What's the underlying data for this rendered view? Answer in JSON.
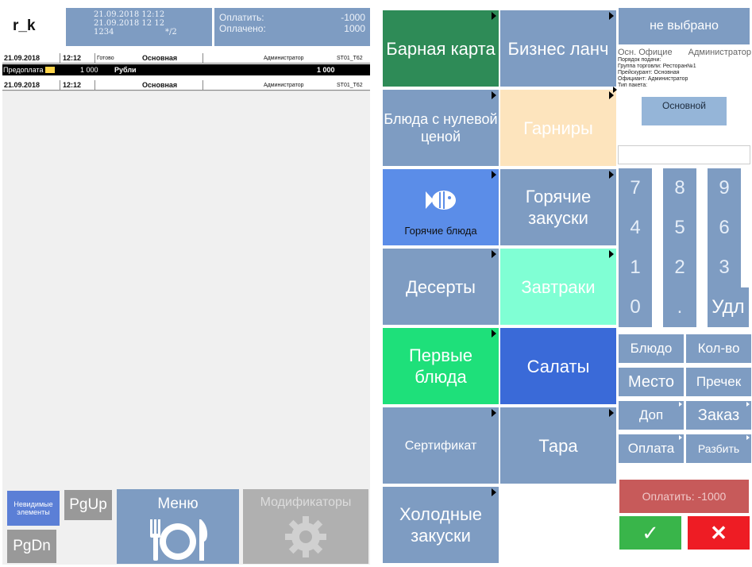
{
  "header": {
    "user": "r_k",
    "time_1": "21.09.2018 12:12",
    "time_2": "21.09.2018 12 12",
    "code": "1234",
    "guests": "*/2",
    "pay_label": "Оплатить:",
    "pay_value": "-1000",
    "paid_label": "Оплачено:",
    "paid_value": "1000"
  },
  "orders": [
    {
      "date": "21.09.2018",
      "time": "12:12",
      "status": "Готово",
      "type": "Основная",
      "waiter": "Администратор",
      "table": "ST01_T62"
    },
    {
      "date": "21.09.2018",
      "time": "12:12",
      "status": "",
      "type": "Основная",
      "waiter": "Администратор",
      "table": "ST01_T62"
    }
  ],
  "prepay": {
    "label": "Предоплата",
    "amount": "1 000",
    "currency": "Рубли",
    "total": "1 000"
  },
  "bottom_left": {
    "invisible": "Невидимые элементы",
    "pgup": "PgUp",
    "pgdn": "PgDn",
    "menu": "Меню",
    "modifiers": "Модификаторы"
  },
  "categories": [
    {
      "label": "Барная карта",
      "color": "#2e8b57"
    },
    {
      "label": "Бизнес ланч",
      "color": "#7e9cc2"
    },
    {
      "label": "Блюда с нулевой ценой",
      "color": "#7e9cc2"
    },
    {
      "label": "Гарниры",
      "color": "#fde4bd"
    },
    {
      "label": "Горячие блюда",
      "color": "#5b8de8"
    },
    {
      "label": "Горячие закуски",
      "color": "#7e9cc2"
    },
    {
      "label": "Десерты",
      "color": "#7e9cc2"
    },
    {
      "label": "Завтраки",
      "color": "#80ffd4"
    },
    {
      "label": "Первые блюда",
      "color": "#1ee07a"
    },
    {
      "label": "Салаты",
      "color": "#3a6ad8"
    },
    {
      "label": "Сертификат",
      "color": "#7e9cc2"
    },
    {
      "label": "Тара",
      "color": "#7e9cc2"
    },
    {
      "label": "Холодные закуски",
      "color": "#7e9cc2"
    }
  ],
  "right": {
    "not_selected": "не выбрано",
    "main_officiant": "Осн. Официе",
    "admin": "Администратор",
    "line1": "Порядок подачи:",
    "line2": "Группа торговли: Ресторан№1",
    "line3": "Прейскурант: Основная",
    "line4": "Официант: Администратор",
    "line5": "Тип пакета:",
    "main_button": "Основной",
    "keys": [
      "7",
      "8",
      "9",
      "4",
      "5",
      "6",
      "1",
      "2",
      "3",
      "0",
      ".",
      "Удл"
    ],
    "fn": [
      "Блюдо",
      "Кол-во",
      "Место",
      "Пречек",
      "Доп",
      "Заказ",
      "Оплата",
      "Разбить"
    ],
    "pay": "Оплатить: -1000",
    "ok": "✓",
    "cancel": "✕"
  }
}
